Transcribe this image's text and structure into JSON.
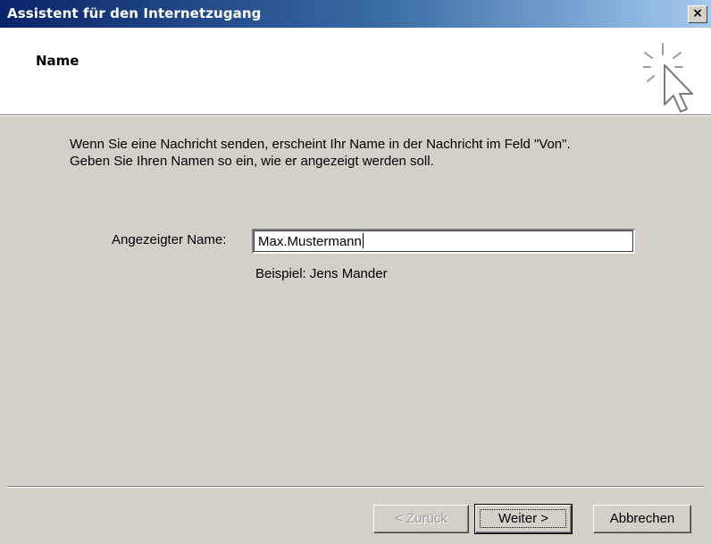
{
  "window": {
    "title": "Assistent für den Internetzugang",
    "close_label": "×"
  },
  "header": {
    "title": "Name",
    "icon": "wizard-cursor-sparkle-icon"
  },
  "main": {
    "description_line1": "Wenn Sie eine Nachricht senden, erscheint Ihr Name in der Nachricht im Feld \"Von\".",
    "description_line2": "Geben Sie Ihren Namen so ein, wie er angezeigt werden soll.",
    "display_name_label": "Angezeigter Name:",
    "display_name_value": "Max.Mustermann",
    "example_text": "Beispiel: Jens Mander"
  },
  "footer": {
    "back_label": "< Zurück",
    "back_enabled": false,
    "next_label": "Weiter >",
    "cancel_label": "Abbrechen"
  },
  "colors": {
    "titlebar_start": "#0a246a",
    "titlebar_end": "#a6caf0",
    "dialog_bg": "#d4d0c8",
    "header_bg": "#ffffff"
  }
}
